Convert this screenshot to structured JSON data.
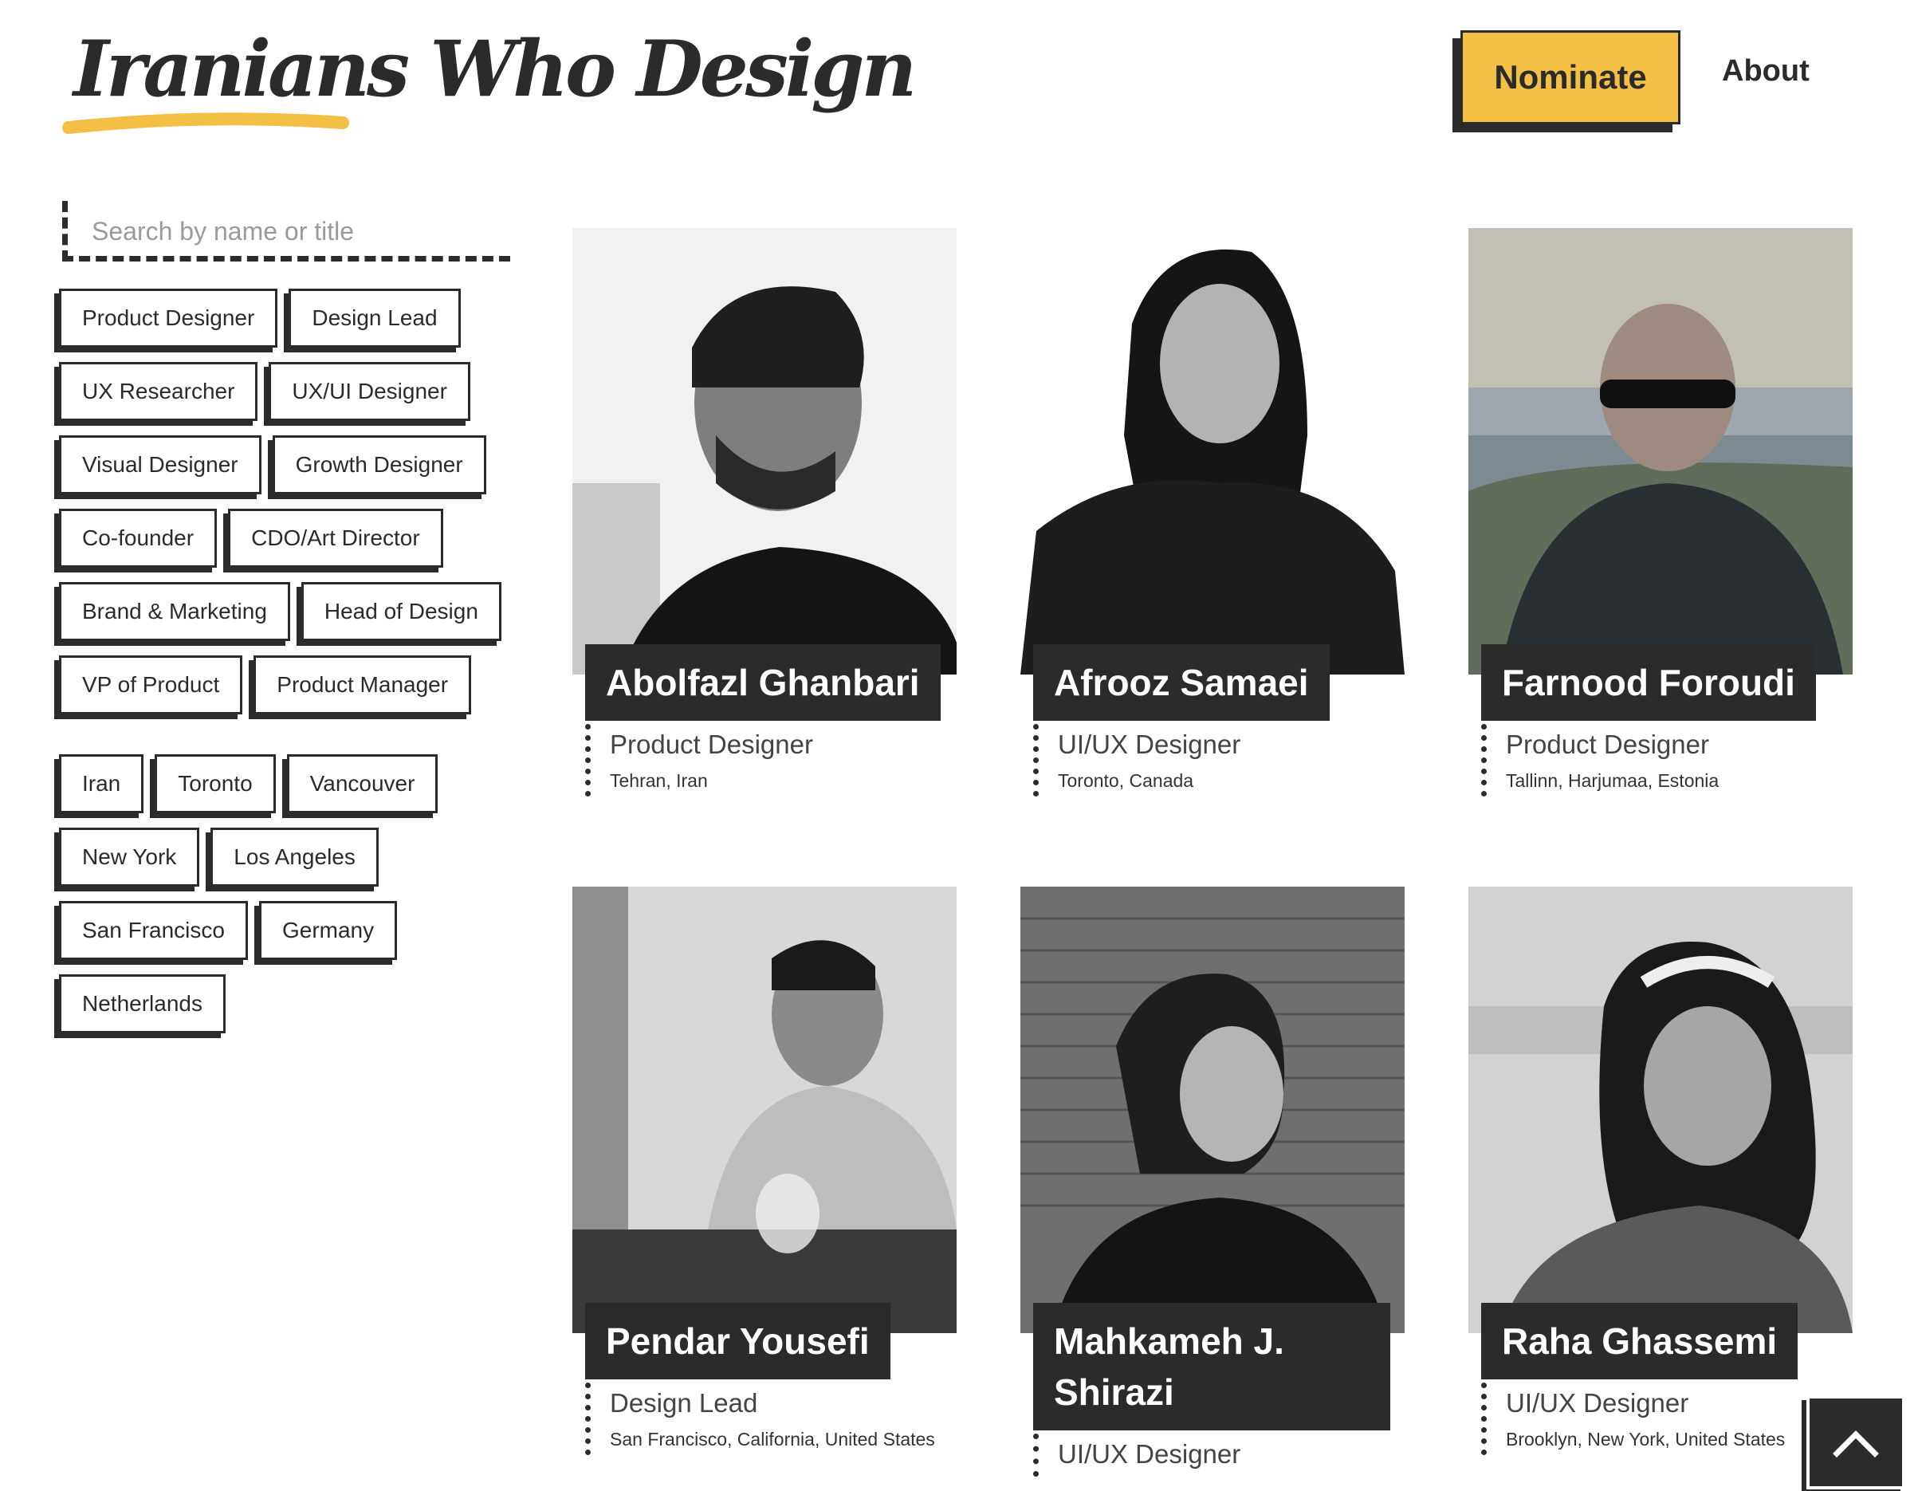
{
  "header": {
    "logo_text": "Iranians Who Design",
    "nominate_label": "Nominate",
    "about_label": "About"
  },
  "search": {
    "placeholder": "Search by name or title"
  },
  "role_filters": [
    "Product Designer",
    "Design Lead",
    "UX Researcher",
    "UX/UI Designer",
    "Visual Designer",
    "Growth Designer",
    "Co-founder",
    "CDO/Art Director",
    "Brand & Marketing",
    "Head of Design",
    "VP of Product",
    "Product Manager"
  ],
  "location_filters": [
    "Iran",
    "Toronto",
    "Vancouver",
    "New York",
    "Los Angeles",
    "San Francisco",
    "Germany",
    "Netherlands"
  ],
  "designers": [
    {
      "name": "Abolfazl Ghanbari",
      "title": "Product Designer",
      "location": "Tehran, Iran"
    },
    {
      "name": "Afrooz Samaei",
      "title": "UI/UX Designer",
      "location": "Toronto, Canada"
    },
    {
      "name": "Farnood Foroudi",
      "title": "Product Designer",
      "location": "Tallinn, Harjumaa, Estonia"
    },
    {
      "name": "Pendar Yousefi",
      "title": "Design Lead",
      "location": "San Francisco, California, United States"
    },
    {
      "name": "Mahkameh J. Shirazi",
      "title": "UI/UX Designer",
      "location": ""
    },
    {
      "name": "Raha Ghassemi",
      "title": "UI/UX Designer",
      "location": "Brooklyn, New York, United States"
    }
  ],
  "colors": {
    "accent": "#f3bf45",
    "ink": "#2b2b2b"
  },
  "icons": {
    "scroll_top": "chevron-up-icon"
  }
}
